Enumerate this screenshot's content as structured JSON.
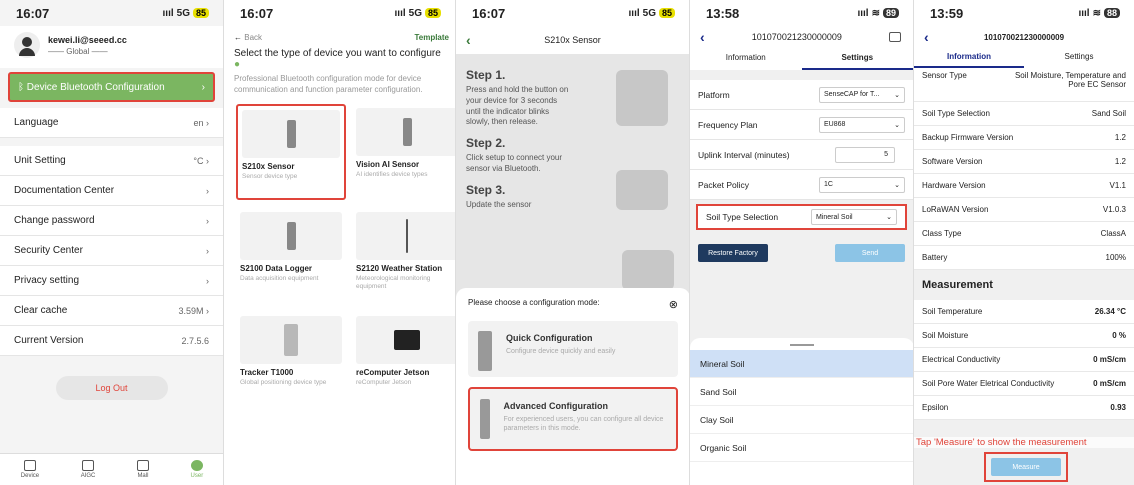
{
  "p1": {
    "time": "16:07",
    "signal": "5G",
    "battery": "85",
    "email": "kewei.li@seeed.cc",
    "region": "—— Global ——",
    "bt_label": "Device Bluetooth Configuration",
    "menu": [
      {
        "label": "Language",
        "value": "en"
      },
      {
        "label": "Unit Setting",
        "value": "°C"
      },
      {
        "label": "Documentation Center",
        "value": ""
      },
      {
        "label": "Change password",
        "value": ""
      },
      {
        "label": "Security Center",
        "value": ""
      },
      {
        "label": "Privacy setting",
        "value": ""
      },
      {
        "label": "Clear cache",
        "value": "3.59M"
      },
      {
        "label": "Current Version",
        "value": "2.7.5.6"
      }
    ],
    "logout": "Log Out",
    "tabs": [
      "Device",
      "AIGC",
      "Mall",
      "User"
    ]
  },
  "p2": {
    "time": "16:07",
    "signal": "5G",
    "battery": "85",
    "back": "Back",
    "template": "Template",
    "heading": "Select the type of device you want to configure",
    "desc": "Professional Bluetooth configuration mode for device communication and function parameter configuration.",
    "devices": [
      {
        "name": "S210x Sensor",
        "sub": "Sensor device type"
      },
      {
        "name": "Vision AI Sensor",
        "sub": "AI identifies device types"
      },
      {
        "name": "S2100 Data Logger",
        "sub": "Data acquisition equipment"
      },
      {
        "name": "S2120 Weather Station",
        "sub": "Meteorological monitoring equipment"
      },
      {
        "name": "Tracker T1000",
        "sub": "Global positioning device type"
      },
      {
        "name": "reComputer Jetson",
        "sub": "reComputer Jetson"
      }
    ]
  },
  "p3": {
    "time": "16:07",
    "signal": "5G",
    "battery": "85",
    "title": "S210x Sensor",
    "steps": [
      {
        "title": "Step 1.",
        "text": "Press and hold the button on your device for 3 seconds until the indicator blinks slowly, then release."
      },
      {
        "title": "Step 2.",
        "text": "Click setup to connect your sensor via Bluetooth."
      },
      {
        "title": "Step 3.",
        "text": "Update the sensor"
      }
    ],
    "sheet_q": "Please choose a configuration mode:",
    "close": "⊗",
    "opts": [
      {
        "title": "Quick Configuration",
        "sub": "Configure device quickly and easily"
      },
      {
        "title": "Advanced Configuration",
        "sub": "For experienced users, you can configure all device parameters in this mode."
      }
    ]
  },
  "p4": {
    "time": "13:58",
    "battery": "89",
    "device_id": "101070021230000009",
    "tabs": [
      "Information",
      "Settings"
    ],
    "rows": [
      {
        "label": "Platform",
        "value": "SenseCAP for T..."
      },
      {
        "label": "Frequency Plan",
        "value": "EU868"
      },
      {
        "label": "Uplink Interval (minutes)",
        "value": "5"
      },
      {
        "label": "Packet Policy",
        "value": "1C"
      },
      {
        "label": "Soil Type Selection",
        "value": "Mineral Soil"
      }
    ],
    "restore": "Restore Factory",
    "send": "Send",
    "picker": [
      "Mineral Soil",
      "Sand Soil",
      "Clay Soil",
      "Organic Soil"
    ]
  },
  "p5": {
    "time": "13:59",
    "battery": "88",
    "device_id": "101070021230000009",
    "tabs": [
      "Information",
      "Settings"
    ],
    "info": [
      {
        "label": "Sensor Type",
        "value": "Soil Moisture, Temperature and Pore EC Sensor"
      },
      {
        "label": "Soil Type Selection",
        "value": "Sand Soil"
      },
      {
        "label": "Backup Firmware Version",
        "value": "1.2"
      },
      {
        "label": "Software Version",
        "value": "1.2"
      },
      {
        "label": "Hardware Version",
        "value": "V1.1"
      },
      {
        "label": "LoRaWAN Version",
        "value": "V1.0.3"
      },
      {
        "label": "Class Type",
        "value": "ClassA"
      },
      {
        "label": "Battery",
        "value": "100%"
      }
    ],
    "measure_title": "Measurement",
    "measurements": [
      {
        "label": "Soil Temperature",
        "value": "26.34 °C"
      },
      {
        "label": "Soil Moisture",
        "value": "0 %"
      },
      {
        "label": "Electrical Conductivity",
        "value": "0 mS/cm"
      },
      {
        "label": "Soil Pore Water Eletrical Conductivity",
        "value": "0 mS/cm"
      },
      {
        "label": "Epsilon",
        "value": "0.93"
      }
    ],
    "hint": "Tap 'Measure' to show the measurement",
    "measure_btn": "Measure"
  },
  "colors": {
    "accent_green": "#7bb661",
    "highlight_red": "#e0443a",
    "nav_blue": "#1a2a8a"
  }
}
